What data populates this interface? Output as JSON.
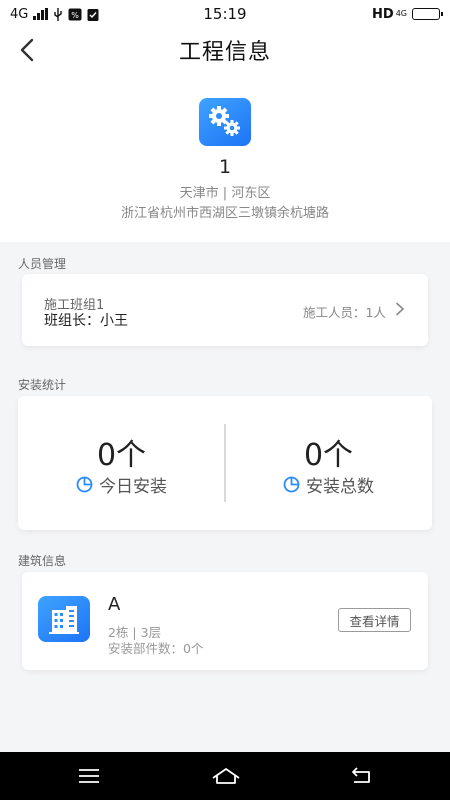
{
  "statusbar": {
    "network": "4G",
    "time": "15:19",
    "hd": "HD",
    "network_right": "4G"
  },
  "header": {
    "title": "工程信息"
  },
  "project": {
    "name": "1",
    "region": "天津市 | 河东区",
    "address": "浙江省杭州市西湖区三墩镇余杭塘路"
  },
  "personnel": {
    "section_label": "人员管理",
    "team_name": "施工班组1",
    "leader": "班组长：小王",
    "workers": "施工人员：1人"
  },
  "stats": {
    "section_label": "安装统计",
    "today_value": "0个",
    "today_label": "今日安装",
    "total_value": "0个",
    "total_label": "安装总数"
  },
  "building": {
    "section_label": "建筑信息",
    "name": "A",
    "floors": "2栋 | 3层",
    "parts": "安装部件数：0个",
    "detail_button": "查看详情"
  },
  "colors": {
    "accent": "#2b8cff",
    "background": "#f4f5f7"
  }
}
